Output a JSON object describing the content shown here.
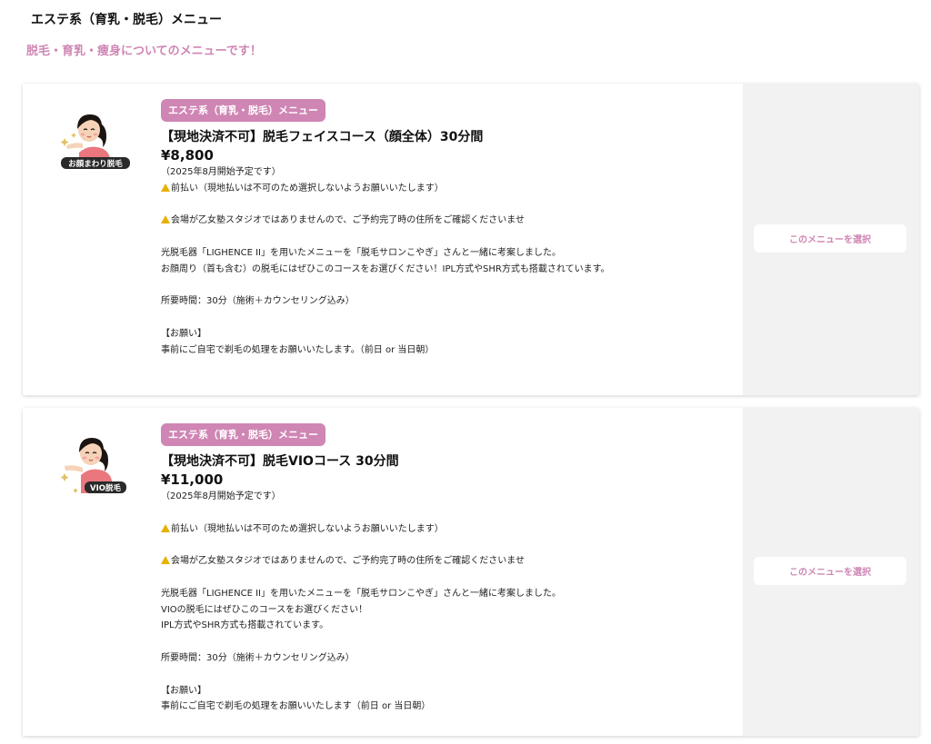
{
  "page": {
    "title": "エステ系（育乳・脱毛）メニュー",
    "subtitle": "脱毛・育乳・痩身についてのメニューです！"
  },
  "colors": {
    "accent": "#cf86b4",
    "panel_bg": "#f2f2f2",
    "warning": "#e8b000"
  },
  "menu_items": [
    {
      "category": "エステ系（育乳・脱毛）メニュー",
      "title": "【現地決済不可】脱毛フェイスコース（顔全体）30分間",
      "price": "¥8,800",
      "thumbnail_icon": "face-hair-removal-illustration-icon",
      "thumbnail_label": "お顔まわり脱毛",
      "description": [
        "（2025年8月開始予定です）",
        "⚠前払い（現地払いは不可のため選択しないようお願いいたします）",
        "",
        "⚠会場が乙女塾スタジオではありませんので、ご予約完了時の住所をご確認くださいませ",
        "",
        "光脱毛器「LIGHENCE II」を用いたメニューを「脱毛サロンこやぎ」さんと一緒に考案しました。",
        "お顔周り（首も含む）の脱毛にはぜひこのコースをお選びください！IPL方式やSHR方式も搭載されています。",
        "",
        "所要時間：30分（施術＋カウンセリング込み）",
        "",
        "【お願い】",
        "事前にご自宅で剃毛の処理をお願いいたします。（前日 or 当日朝）"
      ],
      "select_label": "このメニューを選択"
    },
    {
      "category": "エステ系（育乳・脱毛）メニュー",
      "title": "【現地決済不可】脱毛VIOコース 30分間",
      "price": "¥11,000",
      "thumbnail_icon": "vio-hair-removal-illustration-icon",
      "thumbnail_label": "VIO脱毛",
      "description": [
        "（2025年8月開始予定です）",
        "",
        "⚠前払い（現地払いは不可のため選択しないようお願いいたします）",
        "",
        "⚠会場が乙女塾スタジオではありませんので、ご予約完了時の住所をご確認くださいませ",
        "",
        "光脱毛器「LIGHENCE II」を用いたメニューを「脱毛サロンこやぎ」さんと一緒に考案しました。",
        "VIOの脱毛にはぜひこのコースをお選びください！",
        "IPL方式やSHR方式も搭載されています。",
        "",
        "所要時間：30分（施術＋カウンセリング込み）",
        "",
        "【お願い】",
        "事前にご自宅で剃毛の処理をお願いいたします（前日 or 当日朝）"
      ],
      "select_label": "このメニューを選択"
    }
  ]
}
